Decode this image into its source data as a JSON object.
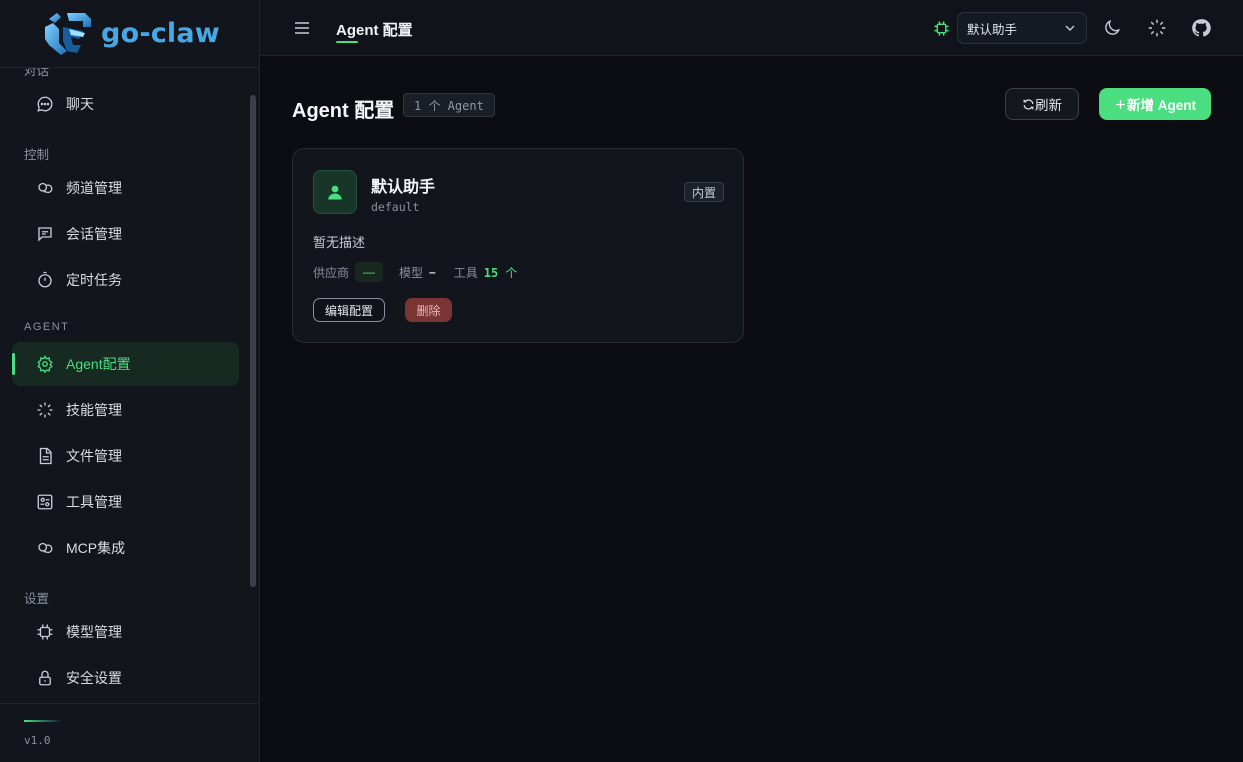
{
  "brand": {
    "name": "go-claw",
    "logo_icon": "claw-logo-icon"
  },
  "sidebar": {
    "sections": {
      "chat_partial": "对话",
      "control": "控制",
      "agent": "AGENT",
      "settings": "设置"
    },
    "items": [
      {
        "key": "chat",
        "label": "聊天",
        "icon": "chat-bubble-icon"
      },
      {
        "key": "channels",
        "label": "频道管理",
        "icon": "link-icon"
      },
      {
        "key": "sessions",
        "label": "会话管理",
        "icon": "message-square-icon"
      },
      {
        "key": "cron",
        "label": "定时任务",
        "icon": "timer-icon"
      },
      {
        "key": "agent_config",
        "label": "Agent配置",
        "icon": "gear-icon",
        "active": true
      },
      {
        "key": "skills",
        "label": "技能管理",
        "icon": "sparkle-loader-icon"
      },
      {
        "key": "files",
        "label": "文件管理",
        "icon": "file-icon"
      },
      {
        "key": "tools",
        "label": "工具管理",
        "icon": "tool-panel-icon"
      },
      {
        "key": "mcp",
        "label": "MCP集成",
        "icon": "link-icon"
      },
      {
        "key": "models",
        "label": "模型管理",
        "icon": "chip-icon"
      },
      {
        "key": "security",
        "label": "安全设置",
        "icon": "lock-icon"
      }
    ],
    "version": "v1.0"
  },
  "topbar": {
    "breadcrumb": "Agent 配置",
    "agent_select": {
      "value": "默认助手"
    },
    "icons": [
      "menu-icon",
      "chip-icon",
      "moon-icon",
      "sparkle-loader-icon",
      "github-icon"
    ]
  },
  "main": {
    "title": "Agent 配置",
    "count_badge": "1 个 Agent",
    "refresh_label": "刷新",
    "add_label": "新增 Agent",
    "accent": "#4ade80",
    "danger": "#7a3434",
    "cards": [
      {
        "name": "默认助手",
        "id": "default",
        "badge": "内置",
        "description": "暂无描述",
        "provider_label": "供应商",
        "provider_value": "—",
        "model_label": "模型",
        "model_value": "–",
        "tools_label": "工具",
        "tools_count": "15",
        "tools_unit": "个",
        "edit_label": "编辑配置",
        "delete_label": "删除"
      }
    ]
  }
}
